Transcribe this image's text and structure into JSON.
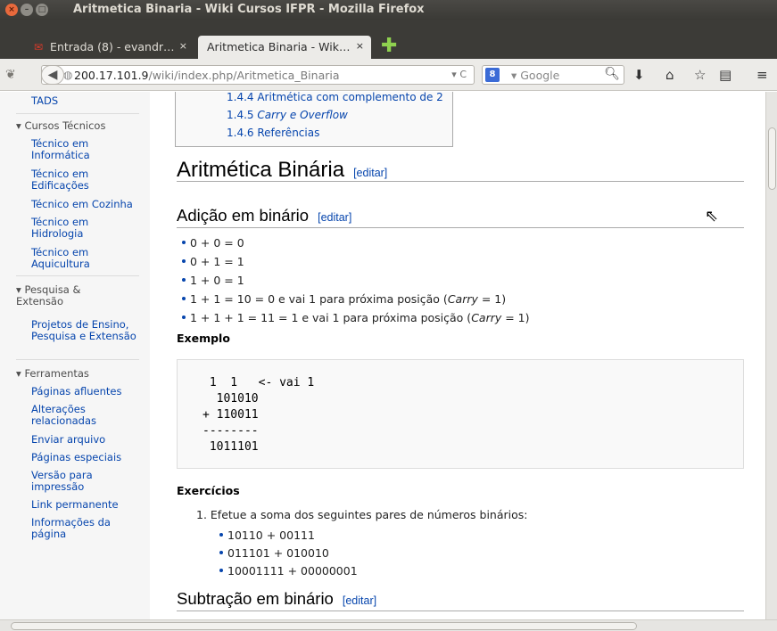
{
  "window": {
    "title": "Aritmetica Binaria - Wiki Cursos IFPR - Mozilla Firefox"
  },
  "tabs": [
    {
      "label": "Entrada (8) - evandr…",
      "close": "×"
    },
    {
      "label": "Aritmetica Binaria - Wik…",
      "close": "×"
    }
  ],
  "newtab_symbol": "✚",
  "navbar": {
    "url_host": "200.17.101.9",
    "url_path": "/wiki/index.php/Aritmetica_Binaria",
    "url_controls": "▾ C",
    "search_engine": "8",
    "search_placeholder": "▾ Google"
  },
  "sidebar": {
    "top_link": "TADS",
    "sections": [
      {
        "heading": "Cursos Técnicos",
        "items": [
          "Técnico em Informática",
          "Técnico em Edificações",
          "Técnico em Cozinha",
          "Técnico em Hidrologia",
          "Técnico em Aquicultura"
        ]
      },
      {
        "heading": "Pesquisa & Extensão",
        "items": [
          "Projetos de Ensino, Pesquisa e Extensão"
        ]
      },
      {
        "heading": "Ferramentas",
        "items": [
          "Páginas afluentes",
          "Alterações relacionadas",
          "Enviar arquivo",
          "Páginas especiais",
          "Versão para impressão",
          "Link permanente",
          "Informações da página"
        ]
      }
    ]
  },
  "toc": [
    "1.4.4 Aritmética com complemento de 2",
    "1.4.5",
    "1.4.6 Referências"
  ],
  "toc_carry": "Carry e Overflow",
  "main": {
    "h1": "Aritmética Binária",
    "edit_label": "[editar]",
    "h2_add": "Adição em binário",
    "add_rules": [
      "0 + 0 = 0",
      "0 + 1 = 1",
      "1 + 0 = 1"
    ],
    "add_rule4_a": "1 + 1 = 10 = 0 e vai 1 para próxima posição (",
    "add_rule5_a": "1 + 1 + 1 = 11 = 1 e vai 1 para próxima posição (",
    "carry_word": "Carry",
    "rule_end": " = 1)",
    "example_label": "Exemplo",
    "pre_lines": [
      " 1  1   <- vai 1",
      "  101010",
      "+ 110011",
      "--------",
      " 1011101"
    ],
    "exercises_label": "Exercícios",
    "exercise_1": "1. Efetue a soma dos seguintes pares de números binários:",
    "exercise_items": [
      "10110 + 00111",
      "011101 + 010010",
      "10001111 + 00000001"
    ],
    "h2_sub": "Subtração em binário"
  }
}
